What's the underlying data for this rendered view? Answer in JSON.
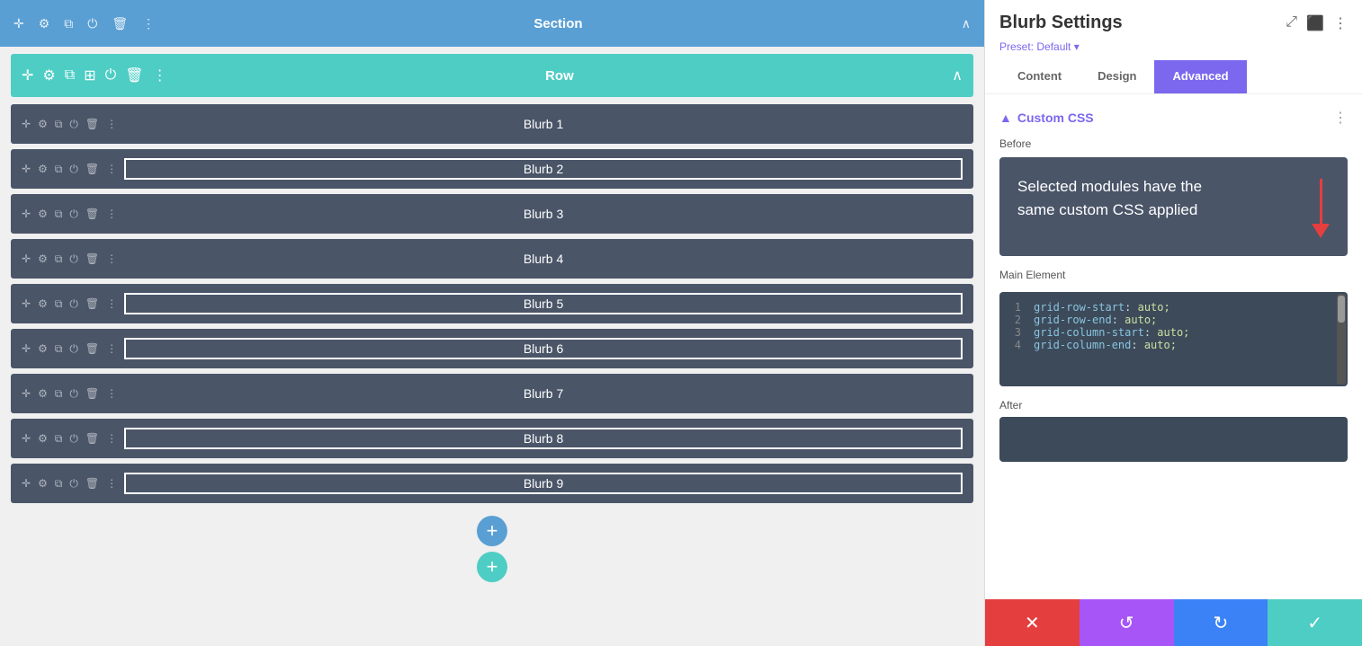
{
  "section_bar": {
    "title": "Section",
    "icons": [
      "move",
      "settings",
      "duplicate",
      "power",
      "trash",
      "more"
    ]
  },
  "row_bar": {
    "title": "Row",
    "icons": [
      "move",
      "settings",
      "duplicate",
      "columns",
      "power",
      "trash",
      "more"
    ]
  },
  "modules": [
    {
      "id": 1,
      "label": "Blurb 1",
      "outlined": false
    },
    {
      "id": 2,
      "label": "Blurb 2",
      "outlined": true
    },
    {
      "id": 3,
      "label": "Blurb 3",
      "outlined": false
    },
    {
      "id": 4,
      "label": "Blurb 4",
      "outlined": false
    },
    {
      "id": 5,
      "label": "Blurb 5",
      "outlined": true
    },
    {
      "id": 6,
      "label": "Blurb 6",
      "outlined": true
    },
    {
      "id": 7,
      "label": "Blurb 7",
      "outlined": false
    },
    {
      "id": 8,
      "label": "Blurb 8",
      "outlined": true
    },
    {
      "id": 9,
      "label": "Blurb 9",
      "outlined": true
    }
  ],
  "panel": {
    "title": "Blurb Settings",
    "preset": "Preset: Default",
    "tabs": [
      "Content",
      "Design",
      "Advanced"
    ],
    "active_tab": "Advanced"
  },
  "custom_css": {
    "section_title": "Custom CSS",
    "before_label": "Before",
    "info_text": "Selected modules have the same custom CSS applied",
    "main_element_label": "Main Element",
    "code_lines": [
      {
        "num": "1",
        "code": "grid-row-start: auto;"
      },
      {
        "num": "2",
        "code": "grid-row-end: auto;"
      },
      {
        "num": "3",
        "code": "grid-column-start: auto;"
      },
      {
        "num": "4",
        "code": "grid-column-end: auto;"
      }
    ],
    "after_label": "After"
  },
  "action_bar": {
    "cancel": "✕",
    "undo": "↺",
    "redo": "↻",
    "confirm": "✓"
  }
}
